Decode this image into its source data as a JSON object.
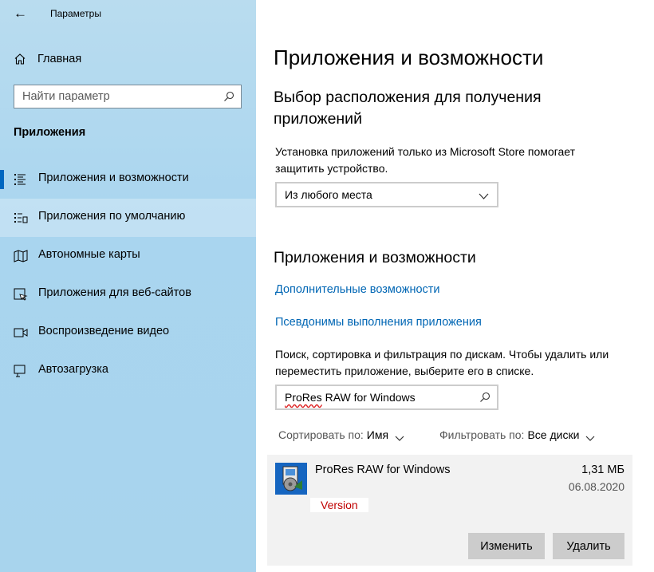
{
  "window": {
    "title": "Параметры"
  },
  "sidebar": {
    "home_label": "Главная",
    "search_placeholder": "Найти параметр",
    "section_title": "Приложения",
    "items": [
      {
        "label": "Приложения и возможности",
        "icon": "apps-list-icon",
        "selected": true
      },
      {
        "label": "Приложения по умолчанию",
        "icon": "default-apps-icon",
        "hovered": true
      },
      {
        "label": "Автономные карты",
        "icon": "map-icon"
      },
      {
        "label": "Приложения для веб-сайтов",
        "icon": "web-apps-icon"
      },
      {
        "label": "Воспроизведение видео",
        "icon": "video-icon"
      },
      {
        "label": "Автозагрузка",
        "icon": "startup-icon"
      }
    ]
  },
  "main": {
    "page_title": "Приложения и возможности",
    "install_section": {
      "heading_line1": "Выбор расположения для получения",
      "heading_line2": "приложений",
      "desc_line1": "Установка приложений только из Microsoft Store помогает",
      "desc_line2": "защитить устройство.",
      "dropdown_value": "Из любого места"
    },
    "apps_section": {
      "heading": "Приложения и возможности",
      "link_optional": "Дополнительные возможности",
      "link_aliases": "Псевдонимы выполнения приложения",
      "desc_line1": "Поиск, сортировка и фильтрация по дискам. Чтобы удалить или",
      "desc_line2": "переместить приложение, выберите его в списке.",
      "search_value_misspelled": "ProRes",
      "search_value_rest": " RAW for Windows",
      "sort_label": "Сортировать по:",
      "sort_value": "Имя",
      "filter_label": "Фильтровать по:",
      "filter_value": "Все диски"
    },
    "app_entry": {
      "name": "ProRes RAW for Windows",
      "size": "1,31 МБ",
      "date": "06.08.2020",
      "version": "Version",
      "modify_label": "Изменить",
      "uninstall_label": "Удалить"
    }
  },
  "colors": {
    "sidebar_bg": "#a9d5ef",
    "accent": "#0067c0",
    "link": "#0066b4",
    "version_text": "#c00000",
    "button_bg": "#cccccc",
    "card_bg": "#f2f2f2"
  }
}
